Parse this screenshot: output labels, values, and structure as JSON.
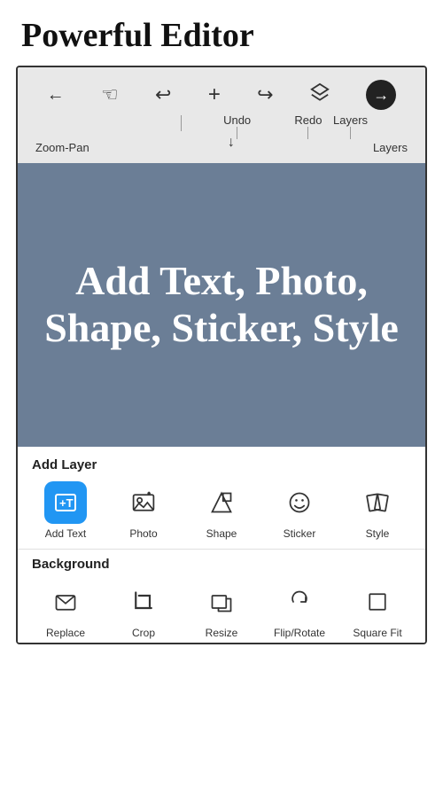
{
  "header": {
    "title": "Powerful Editor"
  },
  "toolbar": {
    "icons": [
      {
        "name": "back-icon",
        "symbol": "←",
        "label": ""
      },
      {
        "name": "zoom-pan-icon",
        "symbol": "✋",
        "label": "Zoom-Pan"
      },
      {
        "name": "undo-icon",
        "symbol": "↩",
        "label": "Undo"
      },
      {
        "name": "add-icon",
        "symbol": "+",
        "label": ""
      },
      {
        "name": "redo-icon",
        "symbol": "↪",
        "label": "Redo"
      },
      {
        "name": "layers-icon",
        "symbol": "⧉",
        "label": "Layers"
      },
      {
        "name": "next-icon",
        "symbol": "→",
        "label": ""
      }
    ],
    "arrow_down": "↓"
  },
  "canvas": {
    "text": "Add Text, Photo, Shape, Sticker, Style"
  },
  "add_layer_section": {
    "title": "Add Layer",
    "tools": [
      {
        "name": "add-text",
        "label": "Add Text",
        "icon": "text"
      },
      {
        "name": "photo",
        "label": "Photo",
        "icon": "photo"
      },
      {
        "name": "shape",
        "label": "Shape",
        "icon": "shape"
      },
      {
        "name": "sticker",
        "label": "Sticker",
        "icon": "sticker"
      },
      {
        "name": "style",
        "label": "Style",
        "icon": "style"
      }
    ]
  },
  "background_section": {
    "title": "Background",
    "tools": [
      {
        "name": "replace",
        "label": "Replace",
        "icon": "replace"
      },
      {
        "name": "crop",
        "label": "Crop",
        "icon": "crop"
      },
      {
        "name": "resize",
        "label": "Resize",
        "icon": "resize"
      },
      {
        "name": "flip-rotate",
        "label": "Flip/Rotate",
        "icon": "flip"
      },
      {
        "name": "square-fit",
        "label": "Square Fit",
        "icon": "square"
      }
    ]
  }
}
